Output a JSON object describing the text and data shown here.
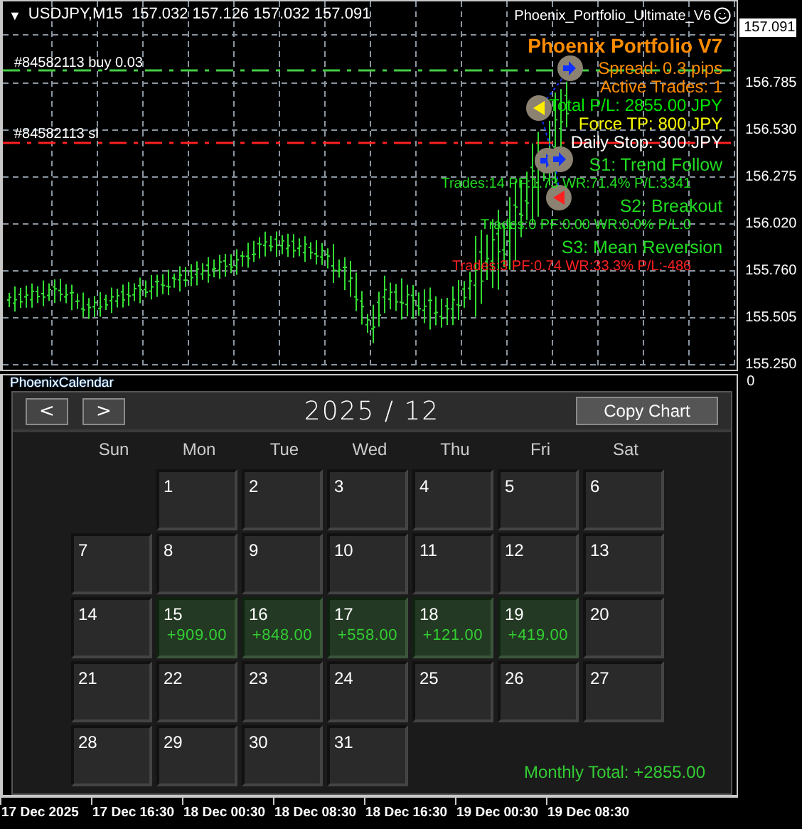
{
  "chart": {
    "menu_arrow": "▼",
    "symbol_line": "USDJPY,M15  157.032 157.126 157.032 157.091",
    "expert": "Phoenix_Portfolio_Ultimate_V6",
    "current_price": "157.091",
    "price_axis": [
      "156.785",
      "156.530",
      "156.275",
      "156.020",
      "155.760",
      "155.505",
      "155.250"
    ],
    "order_labels": [
      {
        "text": "#84582113 buy 0.03",
        "kind": "buy"
      },
      {
        "text": "#84582113 sl",
        "kind": "sl"
      }
    ],
    "overlay": [
      {
        "text": "Phoenix Portfolio V7",
        "kind": "title",
        "color": "#ff8c00"
      },
      {
        "text": "Spread: 0.3 pips",
        "kind": "info",
        "color": "#ff8c00"
      },
      {
        "text": "Active Trades: 1",
        "kind": "info",
        "color": "#ff8c00"
      },
      {
        "text": "Total P/L: 2855.00 JPY",
        "kind": "info",
        "color": "#00e600"
      },
      {
        "text": "Force TP: 800 JPY",
        "kind": "info",
        "color": "#ffff00"
      },
      {
        "text": "Daily Stop: 300 JPY",
        "kind": "info",
        "color": "#ffffff"
      },
      {
        "text": "S1: Trend Follow",
        "kind": "strategy",
        "color": "#22dd22"
      },
      {
        "text": "Trades:14 PF:1.73 WR:71.4% P/L:3341",
        "kind": "stats",
        "color": "#22dd22"
      },
      {
        "text": "S2: Breakout",
        "kind": "strategy",
        "color": "#22dd22"
      },
      {
        "text": "Trades:0 PF:0.00 WR:0.0% P/L:0",
        "kind": "stats",
        "color": "#22dd22"
      },
      {
        "text": "S3: Mean Reversion",
        "kind": "strategy",
        "color": "#22dd22"
      },
      {
        "text": "Trades:3 PF:0.74 WR:33.3% P/L:-486",
        "kind": "stats",
        "color": "#ff2020"
      }
    ]
  },
  "indicator": {
    "name": "PhoenixCalendar",
    "axis_label": "0"
  },
  "calendar": {
    "prev": "<",
    "next": ">",
    "title": "2025 / 12",
    "copy_button": "Copy Chart",
    "weekdays": [
      "Sun",
      "Mon",
      "Tue",
      "Wed",
      "Thu",
      "Fri",
      "Sat"
    ],
    "weeks": [
      [
        {
          "day": "1"
        },
        {
          "day": "2"
        },
        {
          "day": "3"
        },
        {
          "day": "4"
        },
        {
          "day": "5"
        },
        {
          "day": "6"
        }
      ],
      [
        {
          "day": "7"
        },
        {
          "day": "8"
        },
        {
          "day": "9"
        },
        {
          "day": "10"
        },
        {
          "day": "11"
        },
        {
          "day": "12"
        },
        {
          "day": "13"
        }
      ],
      [
        {
          "day": "14"
        },
        {
          "day": "15",
          "profit": "+909.00"
        },
        {
          "day": "16",
          "profit": "+848.00"
        },
        {
          "day": "17",
          "profit": "+558.00"
        },
        {
          "day": "18",
          "profit": "+121.00"
        },
        {
          "day": "19",
          "profit": "+419.00"
        },
        {
          "day": "20"
        }
      ],
      [
        {
          "day": "21"
        },
        {
          "day": "22"
        },
        {
          "day": "23"
        },
        {
          "day": "24"
        },
        {
          "day": "25"
        },
        {
          "day": "26"
        },
        {
          "day": "27"
        }
      ],
      [
        {
          "day": "28"
        },
        {
          "day": "29"
        },
        {
          "day": "30"
        },
        {
          "day": "31"
        }
      ]
    ],
    "monthly_total": "Monthly Total: +2855.00"
  },
  "time_axis": [
    "17 Dec 2025",
    "17 Dec 16:30",
    "18 Dec 00:30",
    "18 Dec 08:30",
    "18 Dec 16:30",
    "19 Dec 00:30",
    "19 Dec 08:30"
  ]
}
